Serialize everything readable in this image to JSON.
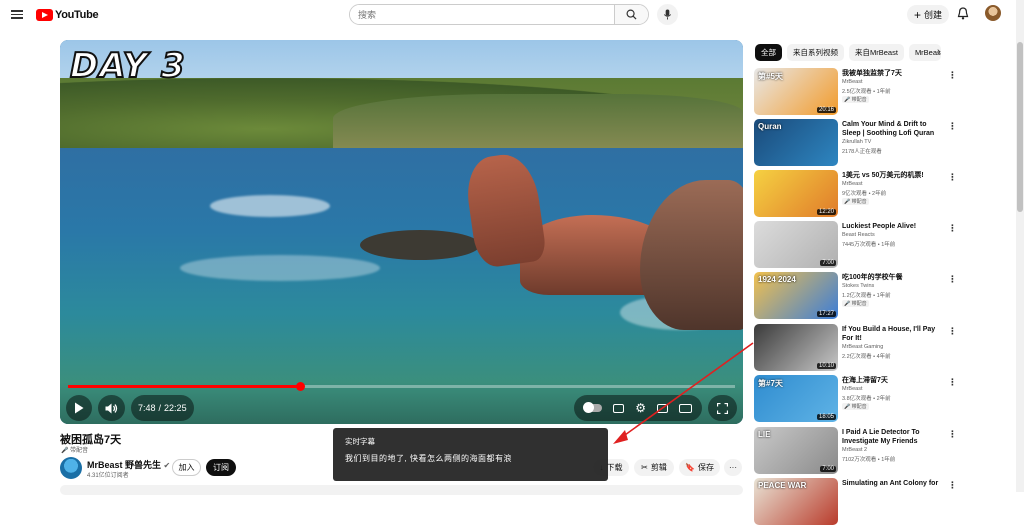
{
  "header": {
    "logo_text": "YouTube",
    "search_placeholder": "搜索",
    "create_label": "创建"
  },
  "video": {
    "overlay_text": "DAY 3",
    "time_current": "7:48",
    "time_separator": "/",
    "time_total": "22:25",
    "progress": 0.348,
    "title": "被困孤岛7天",
    "dubbed_badge": "带配音",
    "channel_name": "MrBeast 野兽先生",
    "subscribers": "4.31亿位订阅者",
    "join_label": "加入",
    "subscribe_label": "订阅",
    "actions": {
      "download": "下载",
      "clip": "剪辑",
      "save": "保存"
    }
  },
  "caption_box": {
    "heading": "实时字幕",
    "text": "我们到目的地了, 快看怎么两侧的海面都有浪"
  },
  "chips": [
    "全部",
    "来自系列视频",
    "来自MrBeast",
    "MrBeast"
  ],
  "recommendations": [
    {
      "title": "我被单独监禁了7天",
      "channel": "MrBeast",
      "meta": "2.5亿次观看 • 1年前",
      "tag": "带配音",
      "duration": "20:16",
      "thumb_text": "第#5天",
      "colors": [
        "#e8e8e8",
        "#f29b2b"
      ]
    },
    {
      "title": "Calm Your Mind & Drift to Sleep | Soothing Lofi Quran for Inner ...",
      "channel": "Zikrullah TV",
      "meta": "2178人正在观看",
      "tag": "",
      "duration": "",
      "thumb_text": "Quran",
      "colors": [
        "#1a4a7a",
        "#2e86c1"
      ]
    },
    {
      "title": "1美元 vs 50万美元的机票!",
      "channel": "MrBeast",
      "meta": "9亿次观看 • 2年前",
      "tag": "带配音",
      "duration": "12:20",
      "thumb_text": "",
      "colors": [
        "#f5d142",
        "#e07b2a"
      ]
    },
    {
      "title": "Luckiest People Alive!",
      "channel": "Beast Reacts",
      "meta": "7445万次观看 • 1年前",
      "tag": "",
      "duration": "7:00",
      "thumb_text": "",
      "colors": [
        "#dcdcdc",
        "#b0b0b0"
      ]
    },
    {
      "title": "吃100年的学校午餐",
      "channel": "Stokes Twins",
      "meta": "1.2亿次观看 • 1年前",
      "tag": "带配音",
      "duration": "17:27",
      "thumb_text": "1924 2024",
      "colors": [
        "#f2c14e",
        "#3b7dd8"
      ]
    },
    {
      "title": "If You Build a House, I'll Pay For It!",
      "channel": "MrBeast Gaming",
      "meta": "2.2亿次观看 • 4年前",
      "tag": "",
      "duration": "10:10",
      "thumb_text": "",
      "colors": [
        "#3a3a3a",
        "#c8c8c8"
      ]
    },
    {
      "title": "在海上滞留7天",
      "channel": "MrBeast",
      "meta": "3.8亿次观看 • 2年前",
      "tag": "带配音",
      "duration": "18:05",
      "thumb_text": "第#7天",
      "colors": [
        "#2f8ccf",
        "#5fb3e6"
      ]
    },
    {
      "title": "I Paid A Lie Detector To Investigate My Friends",
      "channel": "MrBeast 2",
      "meta": "7102万次观看 • 1年前",
      "tag": "",
      "duration": "7:00",
      "thumb_text": "LIE",
      "colors": [
        "#c9c9c9",
        "#8a8a8a"
      ]
    },
    {
      "title": "Simulating an Ant Colony for",
      "channel": "",
      "meta": "",
      "tag": "",
      "duration": "",
      "thumb_text": "PEACE WAR",
      "colors": [
        "#e9e4d6",
        "#b93b2b"
      ]
    }
  ],
  "icons": {
    "verified": "check-circle-icon",
    "accent_red": "#ff0000"
  }
}
